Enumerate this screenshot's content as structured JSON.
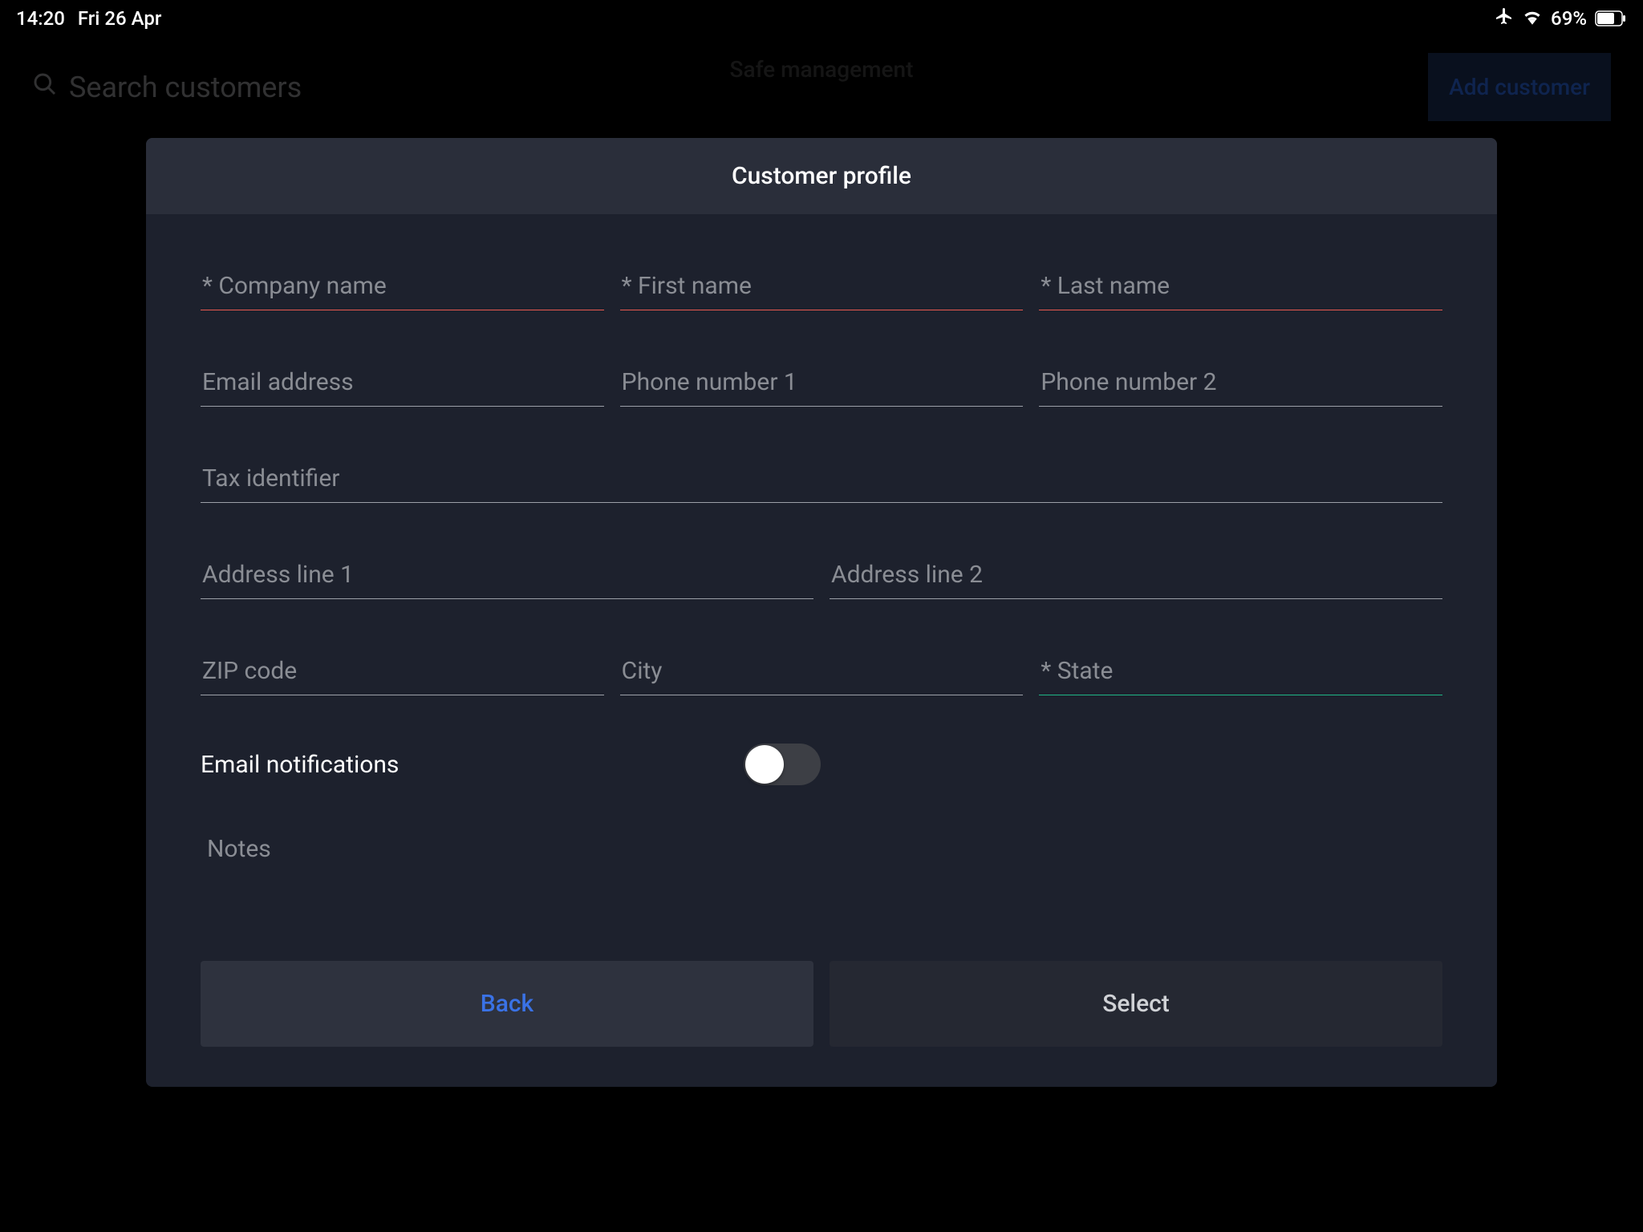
{
  "status_bar": {
    "time": "14:20",
    "date": "Fri 26 Apr",
    "battery": "69%"
  },
  "background": {
    "search_placeholder": "Search customers",
    "page_title": "Safe management",
    "add_customer_label": "Add customer"
  },
  "modal": {
    "title": "Customer profile",
    "fields": {
      "company_name": {
        "placeholder": "* Company name",
        "value": ""
      },
      "first_name": {
        "placeholder": "* First name",
        "value": ""
      },
      "last_name": {
        "placeholder": "* Last name",
        "value": ""
      },
      "email": {
        "placeholder": "Email address",
        "value": ""
      },
      "phone1": {
        "placeholder": "Phone number 1",
        "value": ""
      },
      "phone2": {
        "placeholder": "Phone number 2",
        "value": ""
      },
      "tax_id": {
        "placeholder": "Tax identifier",
        "value": ""
      },
      "address1": {
        "placeholder": "Address line 1",
        "value": ""
      },
      "address2": {
        "placeholder": "Address line 2",
        "value": ""
      },
      "zip": {
        "placeholder": "ZIP code",
        "value": ""
      },
      "city": {
        "placeholder": "City",
        "value": ""
      },
      "state": {
        "placeholder": "* State",
        "value": ""
      }
    },
    "email_notifications_label": "Email notifications",
    "email_notifications_on": false,
    "notes_placeholder": "Notes",
    "back_label": "Back",
    "select_label": "Select"
  }
}
